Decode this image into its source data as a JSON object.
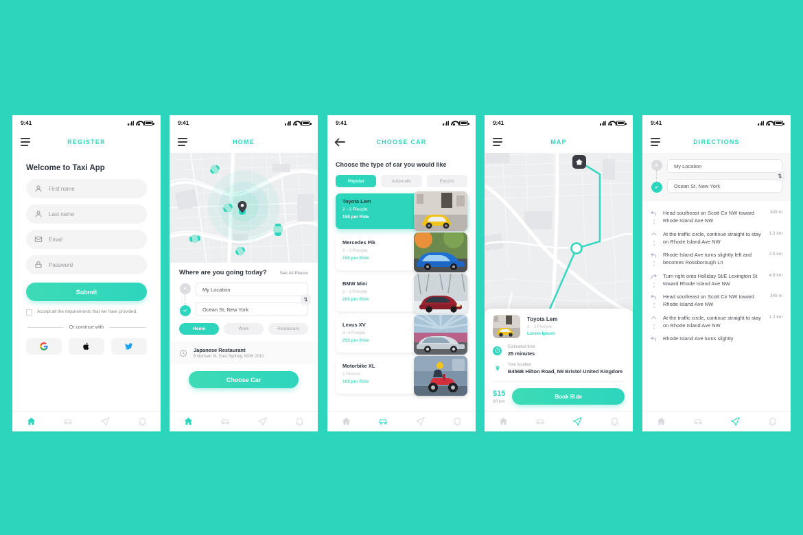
{
  "canvas": {
    "background_color": "#2ed5bd"
  },
  "status_bar": {
    "time": "9:41",
    "icons": [
      "signal-icon",
      "wifi-icon",
      "battery-icon"
    ]
  },
  "screens": {
    "register": {
      "header_title": "REGISTER",
      "welcome": "Welcome to Taxi App",
      "fields": [
        {
          "icon": "user-icon",
          "placeholder": "First name"
        },
        {
          "icon": "user-icon",
          "placeholder": "Last name"
        },
        {
          "icon": "mail-icon",
          "placeholder": "Email"
        },
        {
          "icon": "lock-icon",
          "placeholder": "Password"
        }
      ],
      "submit_label": "Submit",
      "accept_text": "Accept all the requirements that we have provided.",
      "or_label": "Or continue with",
      "socials": [
        "google-icon",
        "apple-icon",
        "twitter-icon"
      ]
    },
    "home": {
      "header_title": "HOME",
      "sheet_title": "Where are you going today?",
      "see_all_label": "See All Places",
      "origin_value": "My Location",
      "destination_value": "Ocean St, New York",
      "swap_label": "⇅",
      "chips": [
        {
          "label": "Home",
          "active": true
        },
        {
          "label": "Work",
          "active": false
        },
        {
          "label": "Restaurant",
          "active": false
        }
      ],
      "recent": {
        "icon": "clock-icon",
        "title": "Japanese Restaurant",
        "subtitle": "8 Norman St, East Sydney, NSW 2010"
      },
      "cta_label": "Choose Car"
    },
    "choose_car": {
      "header_title": "CHOOSE CAR",
      "back_icon": "back-arrow-icon",
      "subtitle": "Choose the type of car you would like",
      "tabs": [
        {
          "label": "Popular",
          "active": true
        },
        {
          "label": "Automatic",
          "active": false
        },
        {
          "label": "Electric",
          "active": false
        }
      ],
      "cars": [
        {
          "name": "Toyota Lem",
          "people": "2 - 3 Pleople",
          "price": "15$ per Ride",
          "selected": true,
          "thumb": "yellow-mini-photo"
        },
        {
          "name": "Mercedes Pik",
          "people": "2 - 3 Pleople",
          "price": "15$ per Ride",
          "selected": false,
          "thumb": "blue-sedan-photo"
        },
        {
          "name": "BMW Mini",
          "people": "2 - 3 Pleople",
          "price": "20$ per Ride",
          "selected": false,
          "thumb": "red-car-snow-photo"
        },
        {
          "name": "Lexus XV",
          "people": "3- 4 People",
          "price": "25$ per Ride",
          "selected": false,
          "thumb": "silver-classic-photo"
        },
        {
          "name": "Motorbike XL",
          "people": "1 Person",
          "price": "10$ per Ride",
          "selected": false,
          "thumb": "red-scooter-photo"
        }
      ]
    },
    "map": {
      "header_title": "MAP",
      "markers": {
        "origin": "home-marker",
        "waypoint": "circle-marker",
        "destination": "car-marker"
      },
      "ride": {
        "name": "Toyota Lem",
        "people": "2 - 3 Pleople",
        "note": "Lorem Ipsum",
        "thumb": "yellow-mini-photo"
      },
      "info": [
        {
          "icon": "clock-icon",
          "label": "Estimated time",
          "value": "25 minutes"
        },
        {
          "icon": "pin-icon",
          "label": "Your location",
          "value": "B456B Hilton Road, N9 Bristol United Kingdom"
        }
      ],
      "price": "$15",
      "distance": "20 km",
      "book_label": "Book Ride"
    },
    "directions": {
      "header_title": "DIRECTIONS",
      "origin_value": "My Location",
      "destination_value": "Ocean St, New York",
      "swap_label": "⇅",
      "steps": [
        {
          "icon": "turn-left-icon",
          "text": "Head southeast on Scott Cir NW toward Rhode Island Ave NW",
          "distance": "345 m"
        },
        {
          "icon": "straight-icon",
          "text": "At the traffic circle, continue straight to stay on Rhode Island Ave NW",
          "distance": "1.2 km"
        },
        {
          "icon": "turn-left-icon",
          "text": "Rhode Island Ave turns slightly left and becomes Rossborough Ln",
          "distance": "2.5 km"
        },
        {
          "icon": "turn-right-icon",
          "text": "Turn right onto Holliday St/E Lexington St toward Rhode Island Ave NW",
          "distance": "4.9 km"
        },
        {
          "icon": "turn-left-icon",
          "text": "Head southeast on Scott Cir NW toward Rhode Island Ave NW",
          "distance": "345 m"
        },
        {
          "icon": "straight-icon",
          "text": "At the traffic circle, continue straight to stay on Rhode Island Ave NW",
          "distance": "1.2 km"
        },
        {
          "icon": "turn-left-icon",
          "text": "Rhode Island Ave turns slightly",
          "distance": ""
        }
      ]
    }
  },
  "bottom_nav": [
    {
      "icon": "home-icon",
      "active_on": [
        "register",
        "home"
      ]
    },
    {
      "icon": "car-icon",
      "active_on": [
        "choose_car"
      ]
    },
    {
      "icon": "send-icon",
      "active_on": [
        "map",
        "directions"
      ]
    },
    {
      "icon": "bell-icon",
      "active_on": []
    }
  ],
  "colors": {
    "accent": "#2ed5bd",
    "background": "#2ed5bd",
    "text_dark": "#2f3640",
    "text_muted": "#9a9aa1",
    "field_bg": "#f4f4f5"
  }
}
